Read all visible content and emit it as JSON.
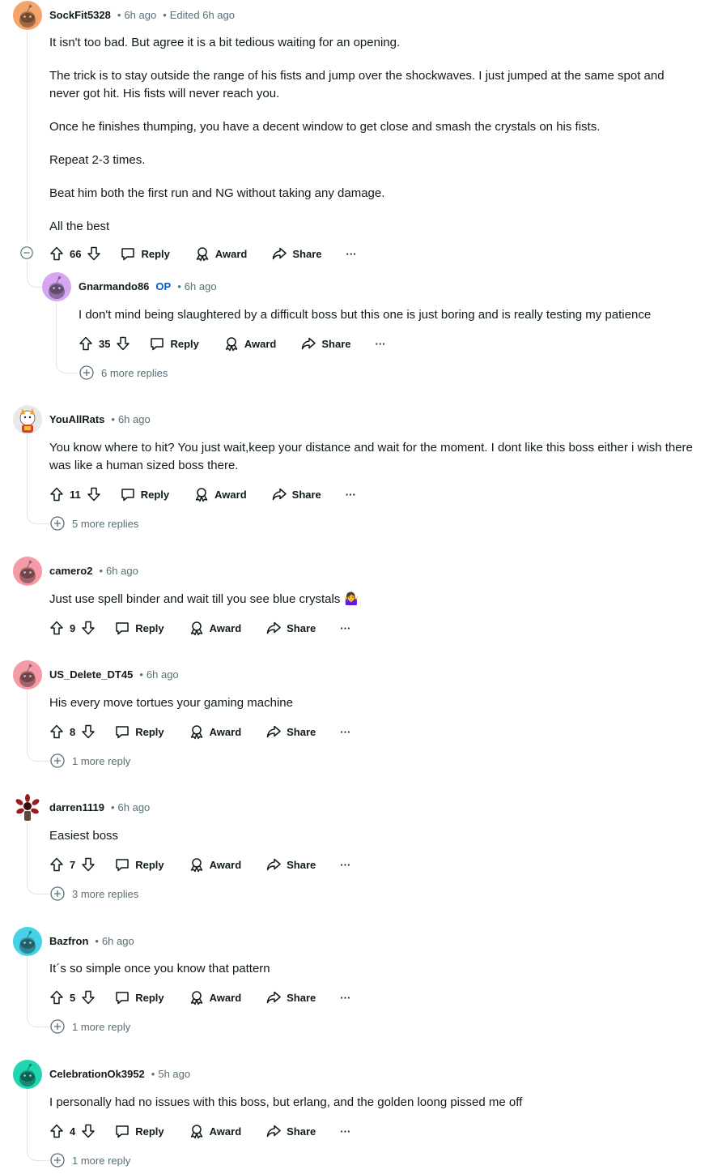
{
  "comments": [
    {
      "user": "SockFit5328",
      "time": "6h ago",
      "edited": "Edited 6h ago",
      "avatar": "orange-snoo-avatar",
      "paragraphs": [
        "It isn't too bad. But agree it is a bit tedious waiting for an opening.",
        "The trick is to stay outside the range of his fists and jump over the shockwaves. I just jumped at the same spot and never got hit. His fists will never reach you.",
        "Once he finishes thumping, you have a decent window to get close and smash the crystals on his fists.",
        "Repeat 2-3 times.",
        "Beat him both the first run and NG without taking any damage.",
        "All the best"
      ],
      "votes": "66"
    },
    {
      "user": "Gnarmando86",
      "op_badge": "OP",
      "time": "6h ago",
      "avatar": "purple-snoo-avatar",
      "text": "I don't mind being slaughtered by a difficult boss but this one is just boring and is really testing my patience",
      "votes": "35",
      "more_replies": "6 more replies"
    },
    {
      "user": "YouAllRats",
      "time": "6h ago",
      "avatar": "custom-snoo-avatar",
      "text": "You know where to hit? You just wait,keep your distance and wait for the moment. I dont like this boss either i wish there was like a human sized boss there.",
      "votes": "11",
      "more_replies": "5 more replies"
    },
    {
      "user": "camero2",
      "time": "6h ago",
      "avatar": "pink-snoo-avatar",
      "text": "Just use spell binder and wait till you see blue crystals 🤷‍♀️",
      "votes": "9"
    },
    {
      "user": "US_Delete_DT45",
      "time": "6h ago",
      "avatar": "pink-snoo-avatar",
      "text": "His every move tortues your gaming machine",
      "votes": "8",
      "more_replies": "1 more reply"
    },
    {
      "user": "darren1119",
      "time": "6h ago",
      "avatar": "demogorgon-avatar",
      "text": "Easiest boss",
      "votes": "7",
      "more_replies": "3 more replies"
    },
    {
      "user": "Bazfron",
      "time": "6h ago",
      "avatar": "cyan-snoo-avatar",
      "text": "It´s so simple once you know that pattern",
      "votes": "5",
      "more_replies": "1 more reply"
    },
    {
      "user": "CelebrationOk3952",
      "time": "5h ago",
      "avatar": "teal-snoo-avatar",
      "text": "I personally had no issues with this boss, but erlang, and the golden loong pissed me off",
      "votes": "4",
      "more_replies": "1 more reply"
    }
  ],
  "actions": {
    "reply": "Reply",
    "award": "Award",
    "share": "Share",
    "more": "···"
  },
  "colors": {
    "text": "#0f1a1c",
    "meta": "#576f76",
    "op": "#0a5cc4",
    "thread_line": "#dfe4e6"
  }
}
